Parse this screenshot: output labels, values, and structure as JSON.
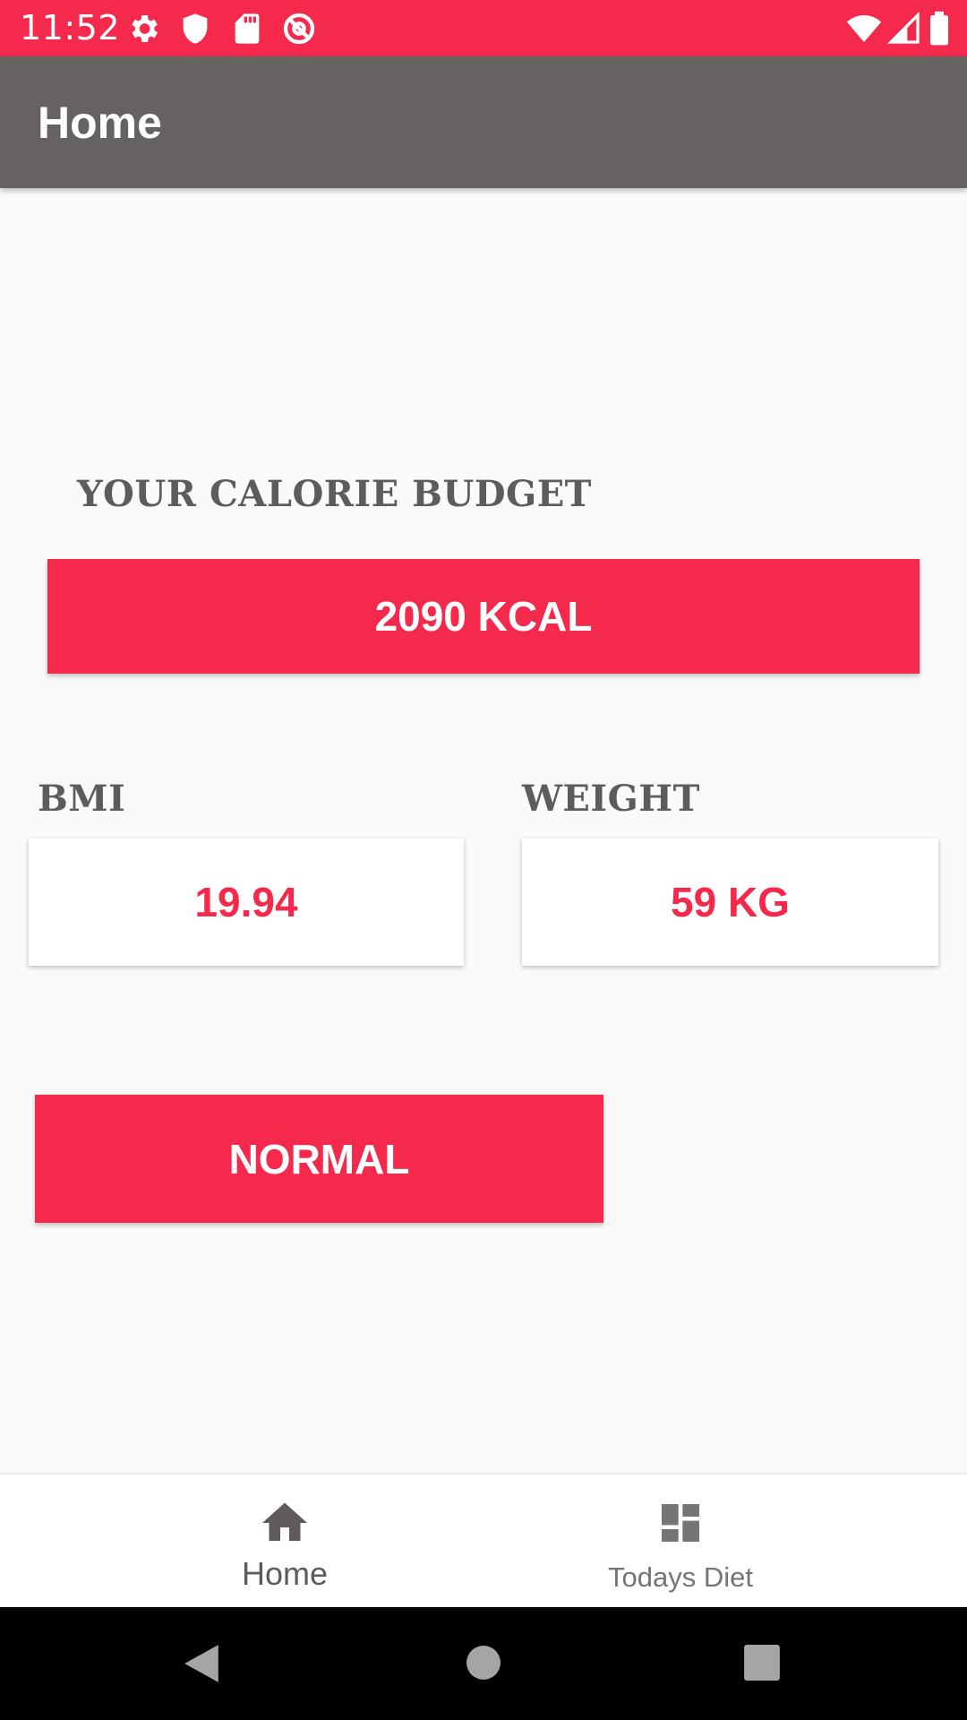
{
  "status_bar": {
    "time": "11:52",
    "icons_left": [
      "gear-icon",
      "shield-icon",
      "sd-card-icon",
      "at-sign-icon"
    ],
    "icons_right": [
      "wifi-icon",
      "signal-icon",
      "battery-icon"
    ]
  },
  "app_bar": {
    "title": "Home"
  },
  "calorie": {
    "label": "YOUR CALORIE BUDGET",
    "value": "2090 KCAL"
  },
  "bmi": {
    "label": "BMI",
    "value": "19.94"
  },
  "weight": {
    "label": "WEIGHT",
    "value": "59 KG"
  },
  "bmi_status": "NORMAL",
  "bottom_nav": {
    "items": [
      {
        "label": "Home",
        "icon": "home-icon",
        "selected": true
      },
      {
        "label": "Todays Diet",
        "icon": "dashboard-icon",
        "selected": false
      }
    ]
  },
  "colors": {
    "accent": "#f5294b",
    "app_bar": "#666261",
    "label_text": "#5e5b5a"
  }
}
